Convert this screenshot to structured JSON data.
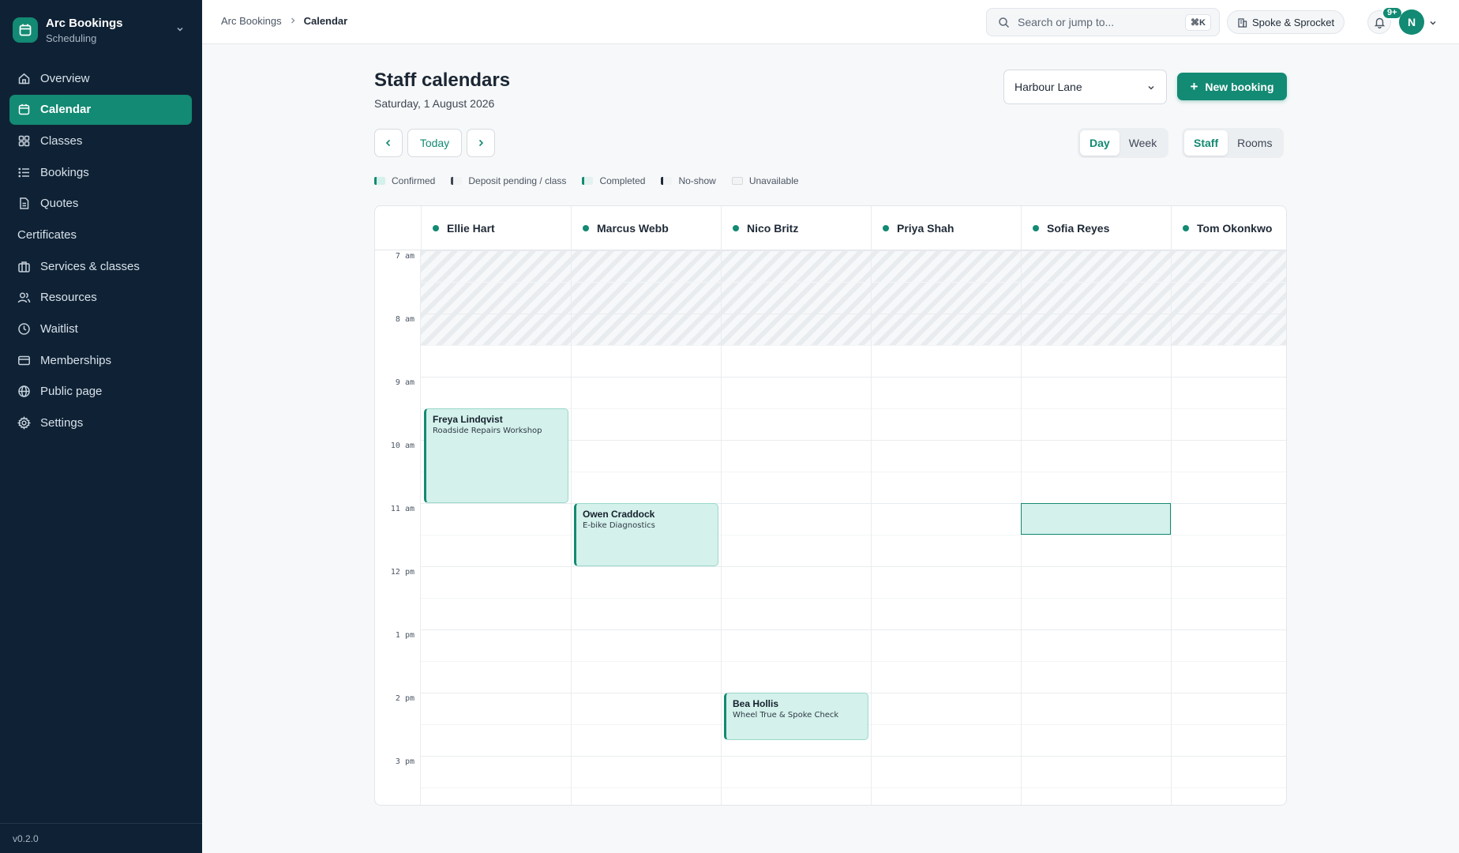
{
  "brand": {
    "name": "Arc Bookings",
    "sub": "Scheduling"
  },
  "sidebar": {
    "items": [
      {
        "label": "Overview"
      },
      {
        "label": "Calendar"
      },
      {
        "label": "Classes"
      },
      {
        "label": "Bookings"
      },
      {
        "label": "Quotes"
      },
      {
        "label": "Certificates"
      },
      {
        "label": "Services & classes"
      },
      {
        "label": "Resources"
      },
      {
        "label": "Waitlist"
      },
      {
        "label": "Memberships"
      },
      {
        "label": "Public page"
      },
      {
        "label": "Settings"
      }
    ],
    "version": "v0.2.0"
  },
  "topbar": {
    "breadcrumb": [
      "Arc Bookings",
      "Calendar"
    ],
    "search_placeholder": "Search or jump to...",
    "search_shortcut": "⌘K",
    "org": "Spoke & Sprocket",
    "notif_count": "9+",
    "avatar_initial": "N"
  },
  "header": {
    "title": "Staff calendars",
    "date": "Saturday, 1 August 2026",
    "location": "Harbour Lane",
    "new_booking": "New booking",
    "today": "Today",
    "view_day": "Day",
    "view_week": "Week",
    "mode_staff": "Staff",
    "mode_rooms": "Rooms"
  },
  "legend": [
    {
      "label": "Confirmed",
      "color": "#d4f1eb",
      "edge": "#138a73"
    },
    {
      "label": "Deposit pending / class",
      "color": "#f1f3f5",
      "edge": "#3d4754"
    },
    {
      "label": "Completed",
      "color": "#e3f2ee",
      "edge": "#138a73"
    },
    {
      "label": "No-show",
      "color": "#f1f3f5",
      "edge": "#1f2a37"
    },
    {
      "label": "Unavailable",
      "color": "#f1f3f5",
      "edge": "#d6dbe1"
    }
  ],
  "calendar": {
    "staff": [
      "Ellie Hart",
      "Marcus Webb",
      "Nico Britz",
      "Priya Shah",
      "Sofia Reyes",
      "Tom Okonkwo"
    ],
    "hours": [
      "7 am",
      "8 am",
      "9 am",
      "10 am",
      "11 am",
      "12 pm",
      "1 pm",
      "2 pm",
      "3 pm"
    ],
    "events": [
      {
        "name": "Freya Lindqvist",
        "service": "Roadside Repairs Workshop"
      },
      {
        "name": "Owen Craddock",
        "service": "E-bike Diagnostics"
      },
      {
        "name": "Bea Hollis",
        "service": "Wheel True & Spoke Check"
      }
    ]
  },
  "colors": {
    "accent": "#138a73",
    "sidebar": "#0f2235"
  }
}
